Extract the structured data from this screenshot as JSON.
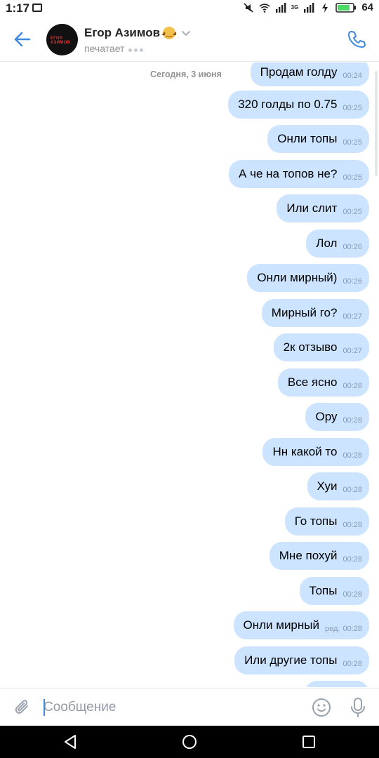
{
  "statusbar": {
    "time": "1:17",
    "battery": "64",
    "network": "3G"
  },
  "header": {
    "name": "Егор Азимов",
    "status": "печатает",
    "avatar_text": "ЕГОР АЗИМОВ"
  },
  "chat": {
    "date_separator": "Сегодня, 3 июня",
    "messages": [
      {
        "text": "Продам голду",
        "time": "00:24"
      },
      {
        "text": "320 голды по 0.75",
        "time": "00:25"
      },
      {
        "text": "Онли топы",
        "time": "00:25"
      },
      {
        "text": "А че на топов не?",
        "time": "00:25"
      },
      {
        "text": "Или слит",
        "time": "00:25"
      },
      {
        "text": "Лол",
        "time": "00:26"
      },
      {
        "text": "Онли мирный)",
        "time": "00:26"
      },
      {
        "text": "Мирный го?",
        "time": "00:27"
      },
      {
        "text": "2к отзыво",
        "time": "00:27"
      },
      {
        "text": "Все ясно",
        "time": "00:28"
      },
      {
        "text": "Ору",
        "time": "00:28"
      },
      {
        "text": "Нн какой то",
        "time": "00:28"
      },
      {
        "text": "Хуи",
        "time": "00:28"
      },
      {
        "text": "Го топы",
        "time": "00:28"
      },
      {
        "text": "Мне похуй",
        "time": "00:28"
      },
      {
        "text": "Топы",
        "time": "00:28"
      },
      {
        "text": "Онли мирный",
        "time": "00:28",
        "edited": "ред."
      },
      {
        "text": "Или другие топы",
        "time": "00:28"
      }
    ]
  },
  "composer": {
    "placeholder": "Сообщение"
  },
  "icons": {
    "back": "arrow-left-icon",
    "call": "phone-icon",
    "attach": "paperclip-icon",
    "emoji": "smile-icon",
    "voice": "microphone-icon"
  },
  "colors": {
    "accent": "#3f8ae0",
    "bubble": "#cce4ff",
    "timestamp": "#8a9bb3"
  }
}
